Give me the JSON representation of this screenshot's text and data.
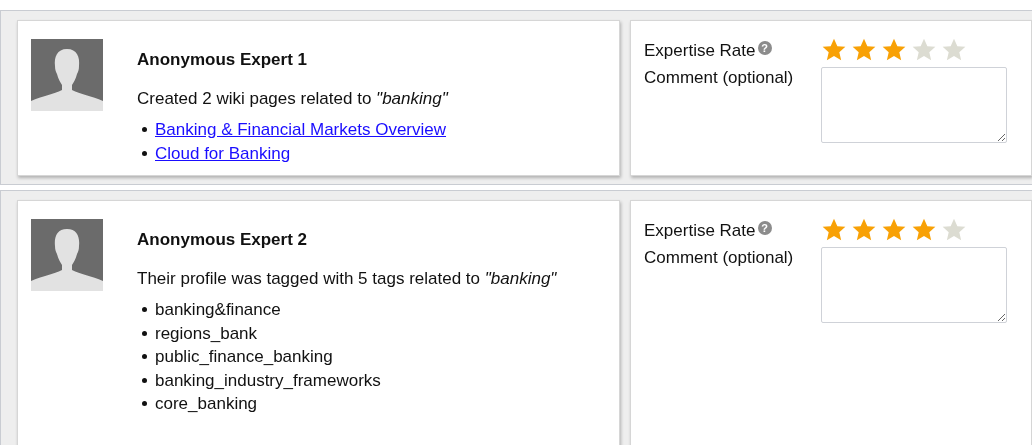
{
  "experts": [
    {
      "name": "Anonymous Expert 1",
      "summary": "Created 2 wiki pages related to *\"banking\"*",
      "items": [
        {
          "kind": "link",
          "text": "Banking & Financial Markets Overview"
        },
        {
          "kind": "link",
          "text": "Cloud for Banking"
        }
      ],
      "rate_label": "Expertise Rate",
      "help": "?",
      "stars": 3,
      "comment_label": "Comment (optional)"
    },
    {
      "name": "Anonymous Expert 2",
      "summary": "Their profile was tagged with 5 tags related to *\"banking\"*",
      "items": [
        {
          "kind": "tag",
          "text": "banking&finance"
        },
        {
          "kind": "tag",
          "text": "regions_bank"
        },
        {
          "kind": "tag",
          "text": "public_finance_banking"
        },
        {
          "kind": "tag",
          "text": "banking_industry_frameworks"
        },
        {
          "kind": "tag",
          "text": "core_banking"
        }
      ],
      "rate_label": "Expertise Rate",
      "help": "?",
      "stars": 4,
      "comment_label": "Comment (optional)"
    }
  ]
}
